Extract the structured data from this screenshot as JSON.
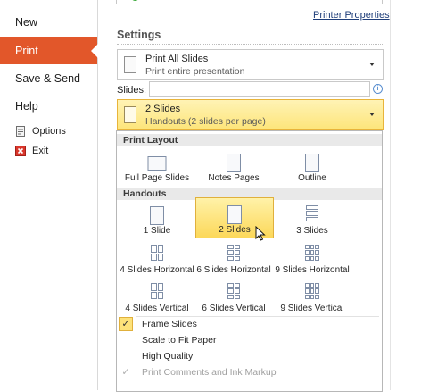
{
  "nav": {
    "new": "New",
    "print": "Print",
    "save_send": "Save & Send",
    "help": "Help",
    "options": "Options",
    "exit": "Exit"
  },
  "printer": {
    "properties_link": "Printer Properties"
  },
  "settings": {
    "title": "Settings",
    "range": {
      "title": "Print All Slides",
      "subtitle": "Print entire presentation"
    },
    "slides_label": "Slides:",
    "slides_value": "",
    "layout": {
      "title": "2 Slides",
      "subtitle": "Handouts (2 slides per page)"
    }
  },
  "popup": {
    "print_layout_header": "Print Layout",
    "print_layout": [
      {
        "label": "Full Page Slides",
        "icon": "full-page-slide-icon"
      },
      {
        "label": "Notes Pages",
        "icon": "notes-pages-icon"
      },
      {
        "label": "Outline",
        "icon": "outline-icon"
      }
    ],
    "handouts_header": "Handouts",
    "handouts": [
      {
        "label": "1 Slide",
        "selected": false
      },
      {
        "label": "2 Slides",
        "selected": true
      },
      {
        "label": "3 Slides",
        "selected": false
      },
      {
        "label": "4 Slides Horizontal",
        "selected": false
      },
      {
        "label": "6 Slides Horizontal",
        "selected": false
      },
      {
        "label": "9 Slides Horizontal",
        "selected": false
      },
      {
        "label": "4 Slides Vertical",
        "selected": false
      },
      {
        "label": "6 Slides Vertical",
        "selected": false
      },
      {
        "label": "9 Slides Vertical",
        "selected": false
      }
    ],
    "options": [
      {
        "label": "Frame Slides",
        "checked": true,
        "enabled": true
      },
      {
        "label": "Scale to Fit Paper",
        "checked": false,
        "enabled": true
      },
      {
        "label": "High Quality",
        "checked": false,
        "enabled": true
      },
      {
        "label": "Print Comments and Ink Markup",
        "checked": true,
        "enabled": false
      }
    ]
  },
  "colors": {
    "accent": "#e2572a",
    "selected_fill": "#fde27a",
    "selected_border": "#e0b03c"
  }
}
